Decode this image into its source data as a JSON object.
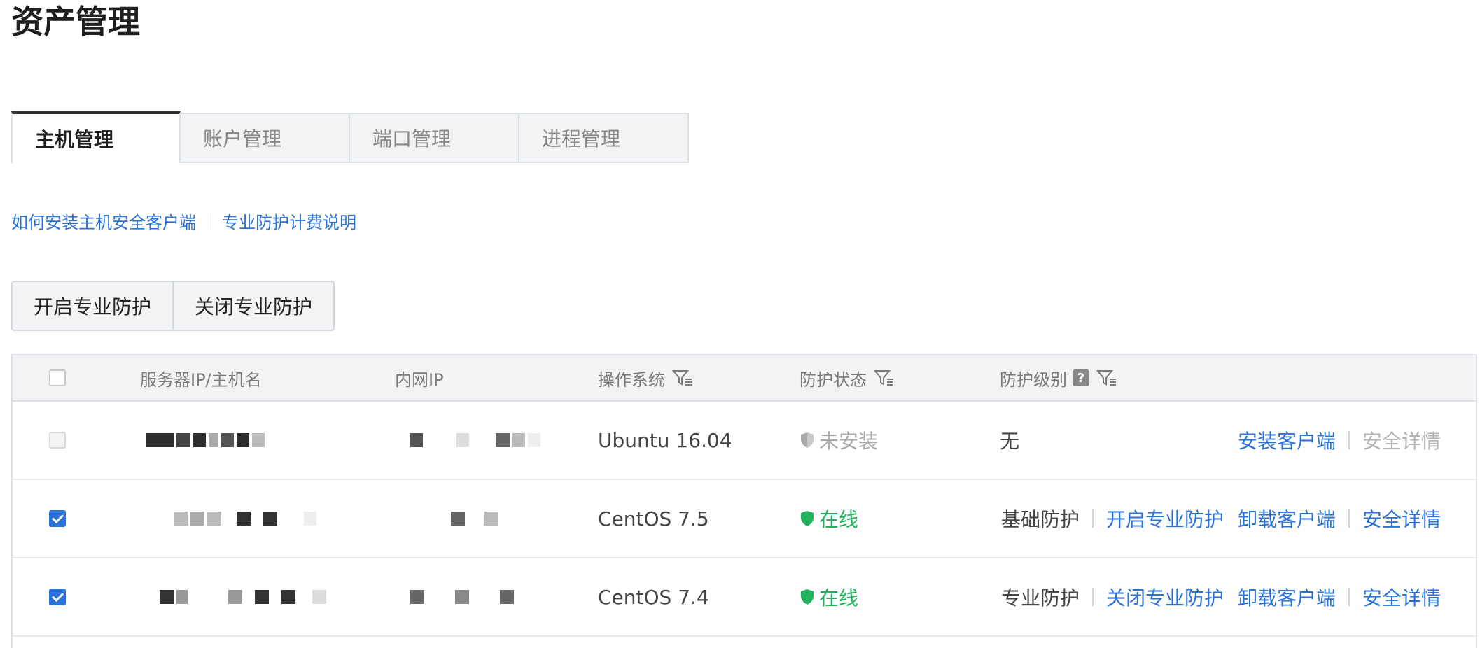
{
  "page": {
    "title": "资产管理"
  },
  "tabs": [
    {
      "label": "主机管理",
      "active": true
    },
    {
      "label": "账户管理",
      "active": false
    },
    {
      "label": "端口管理",
      "active": false
    },
    {
      "label": "进程管理",
      "active": false
    }
  ],
  "links": {
    "install_client": "如何安装主机安全客户端",
    "billing_info": "专业防护计费说明"
  },
  "toolbar": {
    "enable_pro": "开启专业防护",
    "disable_pro": "关闭专业防护"
  },
  "table": {
    "headers": {
      "host": "服务器IP/主机名",
      "private_ip": "内网IP",
      "os": "操作系统",
      "status": "防护状态",
      "level": "防护级别",
      "help": "?"
    },
    "rows": [
      {
        "os": "Ubuntu 16.04",
        "status": "未安装",
        "level": "无",
        "checkbox": "disabled",
        "ops": [
          "安装客户端",
          "安全详情"
        ]
      },
      {
        "os": "CentOS 7.5",
        "status": "在线",
        "level": "基础防护",
        "checkbox": "checked",
        "ops": [
          "开启专业防护",
          "卸载客户端",
          "安全详情"
        ]
      },
      {
        "os": "CentOS 7.4",
        "status": "在线",
        "level": "专业防护",
        "checkbox": "checked",
        "ops": [
          "关闭专业防护",
          "卸载客户端",
          "安全详情"
        ]
      }
    ]
  },
  "colors": {
    "link": "#2b72d6",
    "online": "#22b25b",
    "not_installed": "#aaaaaa"
  },
  "icons": {
    "filter": "filter-icon",
    "shield": "shield-icon",
    "help": "help-icon"
  }
}
